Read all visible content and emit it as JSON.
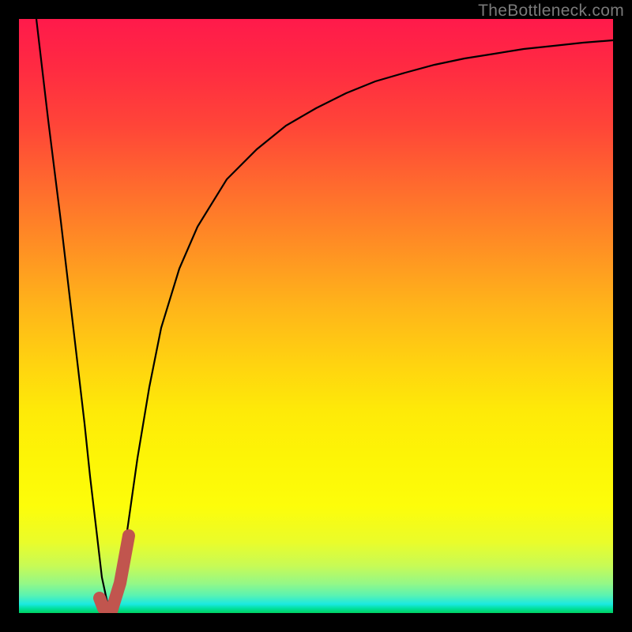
{
  "attribution": "TheBottleneck.com",
  "chart_data": {
    "type": "line",
    "title": "",
    "xlabel": "",
    "ylabel": "",
    "xlim": [
      0,
      100
    ],
    "ylim": [
      0,
      100
    ],
    "background_gradient": {
      "orientation": "vertical",
      "stops": [
        {
          "pos": 0,
          "color": "#ff1a4b"
        },
        {
          "pos": 0.3,
          "color": "#ff7a28"
        },
        {
          "pos": 0.55,
          "color": "#ffcf10"
        },
        {
          "pos": 0.8,
          "color": "#fdfd0a"
        },
        {
          "pos": 0.95,
          "color": "#95f886"
        },
        {
          "pos": 1.0,
          "color": "#00d060"
        }
      ]
    },
    "series": [
      {
        "name": "bottleneck-curve",
        "stroke": "#000000",
        "stroke_width": 2,
        "x": [
          3,
          5,
          7,
          9,
          11,
          12,
          13,
          14,
          15,
          16,
          17,
          18,
          20,
          22,
          24,
          27,
          30,
          35,
          40,
          45,
          50,
          55,
          60,
          65,
          70,
          75,
          80,
          85,
          90,
          95,
          100
        ],
        "y": [
          100,
          83,
          66,
          49,
          32,
          23,
          14,
          6,
          1,
          0,
          4,
          12,
          26,
          38,
          48,
          58,
          65,
          73,
          78,
          82,
          85,
          87.5,
          89.5,
          91,
          92.3,
          93.3,
          94.2,
          94.9,
          95.5,
          96,
          96.4
        ]
      },
      {
        "name": "highlight-segment",
        "stroke": "#c1554e",
        "stroke_width": 14,
        "linecap": "round",
        "x": [
          13.5,
          14.2,
          15.5,
          17.0,
          18.5
        ],
        "y": [
          2.5,
          0.8,
          0.3,
          5,
          13
        ]
      }
    ]
  }
}
